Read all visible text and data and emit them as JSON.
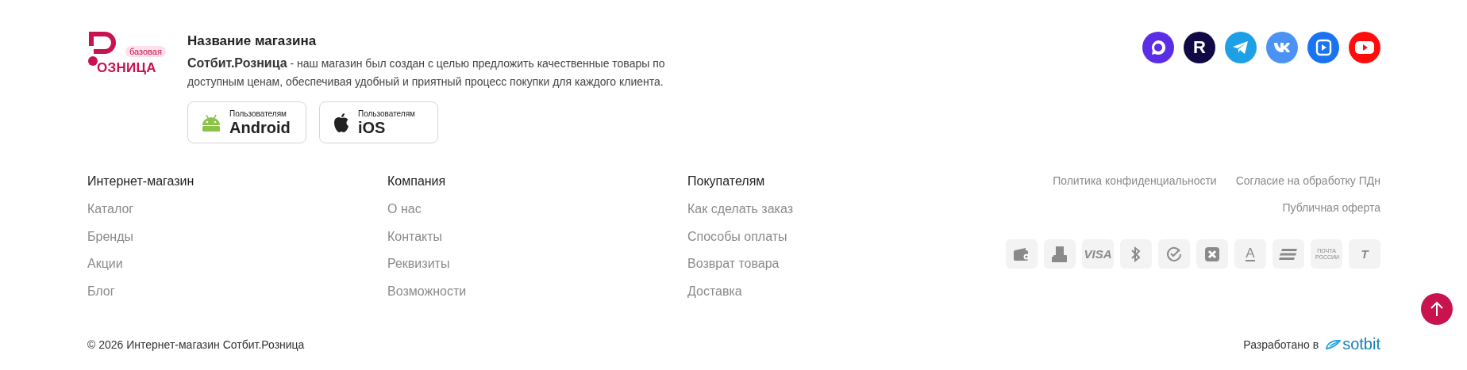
{
  "logo": {
    "badge": "базовая",
    "text": "ОЗНИЦА"
  },
  "store": {
    "title": "Название магазина",
    "description": "**Сотбит.Розница** - наш магазин был создан с целью предложить качественные товары по доступным ценам, обеспечивая удобный и приятный процесс покупки для каждого клиента."
  },
  "app_buttons": [
    {
      "kind": "android",
      "caption": "Пользователям",
      "label": "Android"
    },
    {
      "kind": "apple",
      "caption": "Пользователям",
      "label": "iOS"
    }
  ],
  "social": [
    {
      "kind": "max",
      "color": "#5b2ee6"
    },
    {
      "kind": "rutube",
      "color": "#100943",
      "label": "R"
    },
    {
      "kind": "telegram",
      "color": "#1ea0e6"
    },
    {
      "kind": "vk",
      "color": "#4a93f5"
    },
    {
      "kind": "vkvideo",
      "color": "#1a73f0"
    },
    {
      "kind": "youtube",
      "color": "#ff0d0d"
    }
  ],
  "columns": [
    {
      "heading": "Интернет-магазин",
      "links": [
        "Каталог",
        "Бренды",
        "Акции",
        "Блог"
      ]
    },
    {
      "heading": "Компания",
      "links": [
        "О нас",
        "Контакты",
        "Реквизиты",
        "Возможности"
      ]
    },
    {
      "heading": "Покупателям",
      "links": [
        "Как сделать заказ",
        "Способы оплаты",
        "Возврат товара",
        "Доставка"
      ]
    }
  ],
  "legal_links": [
    "Политика конфиденциальности",
    "Согласие на обработку ПДн",
    "Публичная оферта"
  ],
  "payments": [
    {
      "kind": "wallet"
    },
    {
      "kind": "terminal"
    },
    {
      "kind": "text",
      "label": "VISA"
    },
    {
      "kind": "arrows"
    },
    {
      "kind": "check"
    },
    {
      "kind": "cross"
    },
    {
      "kind": "underlined",
      "label": "A"
    },
    {
      "kind": "stripes"
    },
    {
      "kind": "small",
      "label": "ПОЧТА РОССИИ"
    },
    {
      "kind": "text",
      "label": "T"
    }
  ],
  "copyright": "© 2026 Интернет-магазин Сотбит.Розница",
  "developer": {
    "label": "Разработано в",
    "brand": "sotbit"
  }
}
